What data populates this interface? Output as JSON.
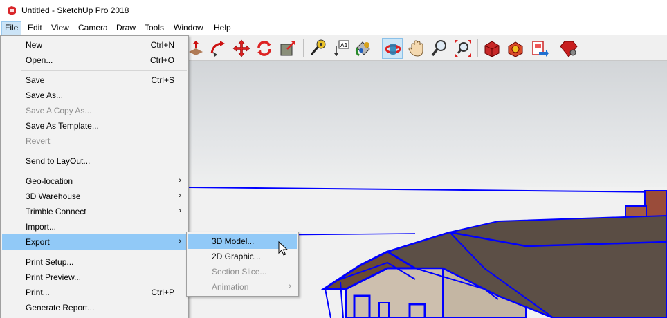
{
  "window": {
    "title": "Untitled - SketchUp Pro 2018"
  },
  "menubar": {
    "items": [
      "File",
      "Edit",
      "View",
      "Camera",
      "Draw",
      "Tools",
      "Window",
      "Help"
    ]
  },
  "file_menu": {
    "items": [
      {
        "label": "New",
        "shortcut": "Ctrl+N"
      },
      {
        "label": "Open...",
        "shortcut": "Ctrl+O"
      },
      {
        "label": "Save",
        "shortcut": "Ctrl+S"
      },
      {
        "label": "Save As..."
      },
      {
        "label": "Save A Copy As...",
        "disabled": true
      },
      {
        "label": "Save As Template..."
      },
      {
        "label": "Revert",
        "disabled": true
      },
      {
        "label": "Send to LayOut..."
      },
      {
        "label": "Geo-location",
        "arrow": "›"
      },
      {
        "label": "3D Warehouse",
        "arrow": "›"
      },
      {
        "label": "Trimble Connect",
        "arrow": "›"
      },
      {
        "label": "Import..."
      },
      {
        "label": "Export",
        "arrow": "›",
        "highlight": true
      },
      {
        "label": "Print Setup..."
      },
      {
        "label": "Print Preview..."
      },
      {
        "label": "Print...",
        "shortcut": "Ctrl+P"
      },
      {
        "label": "Generate Report..."
      }
    ]
  },
  "export_submenu": {
    "items": [
      {
        "label": "3D Model...",
        "highlight": true
      },
      {
        "label": "2D Graphic..."
      },
      {
        "label": "Section Slice...",
        "disabled": true
      },
      {
        "label": "Animation",
        "disabled": true,
        "arrow": "›"
      }
    ]
  },
  "toolbar": {
    "buttons": [
      "push-pull-icon",
      "follow-me-icon",
      "move-icon",
      "rotate-icon",
      "scale-icon",
      "tape-measure-icon",
      "text-icon",
      "paint-bucket-icon",
      "orbit-icon",
      "pan-icon",
      "zoom-icon",
      "zoom-extents-icon",
      "3d-warehouse-icon",
      "extension-warehouse-icon",
      "send-to-layout-icon",
      "extension-manager-icon"
    ],
    "selected": "orbit-icon"
  },
  "colors": {
    "selection_blue": "#0000ff",
    "menu_highlight": "#91c9f7",
    "roof": "#5a4d44",
    "siding": "#cdbfae"
  }
}
